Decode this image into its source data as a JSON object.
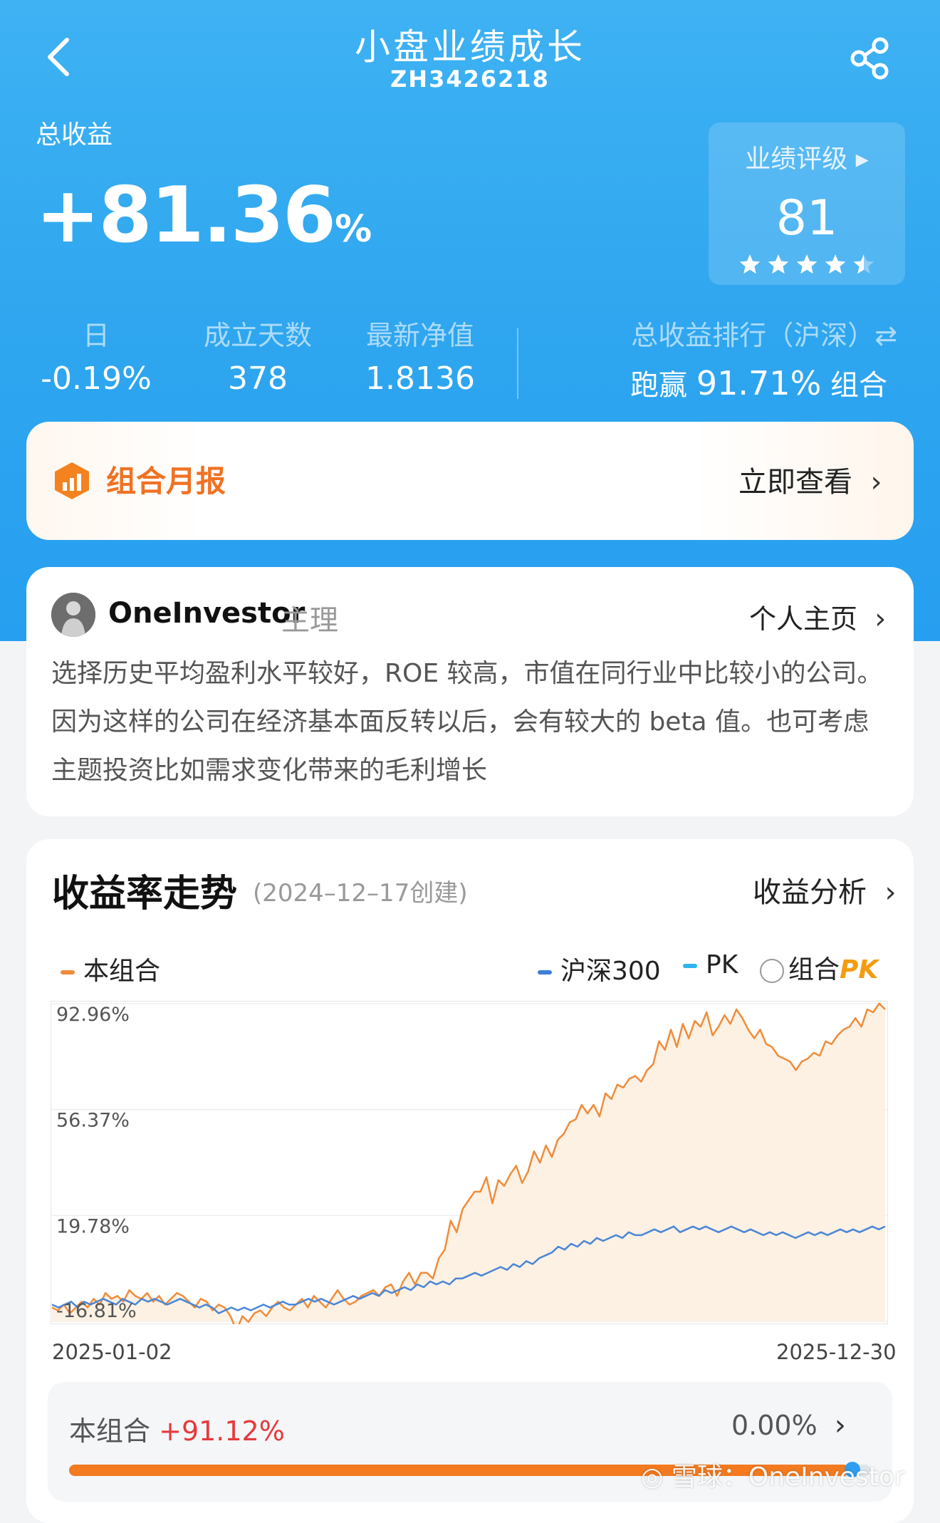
{
  "header": {
    "title": "小盘业绩成长",
    "code": "ZH3426218"
  },
  "total": {
    "label": "总收益",
    "value": "+81.36",
    "unit": "%"
  },
  "rating": {
    "title": "业绩评级 ▸",
    "score": "81",
    "stars": 4.5
  },
  "stats": [
    {
      "label": "日",
      "value": "-0.19%"
    },
    {
      "label": "成立天数",
      "value": "378"
    },
    {
      "label": "最新净值",
      "value": "1.8136"
    }
  ],
  "rank": {
    "label": "总收益排行（沪深）⇄",
    "prefix": "跑赢",
    "value": "91.71%",
    "suffix": "组合"
  },
  "monthly": {
    "label": "组合月报",
    "link": "立即查看"
  },
  "manager": {
    "name": "OneInvestor",
    "role": "主理",
    "homepage": "个人主页",
    "description": "选择历史平均盈利水平较好，ROE 较高，市值在同行业中比较小的公司。因为这样的公司在经济基本面反转以后，会有较大的 beta 值。也可考虑主题投资比如需求变化带来的毛利增长"
  },
  "trend": {
    "title": "收益率走势",
    "subtitle": "(2024–12–17创建)",
    "analysis": "收益分析",
    "legend": {
      "series1": "本组合",
      "series2": "沪深300",
      "pk_prefix": "PK",
      "pk_combo": "组合",
      "pk_mark": "PK"
    },
    "footer": {
      "label": "本组合",
      "value": "+91.12%",
      "right": "0.00%",
      "progress": 0.98
    }
  },
  "chart_data": {
    "type": "line",
    "x_start": "2025-01-02",
    "x_end": "2025-12-30",
    "y_ticks": [
      92.96,
      56.37,
      19.78,
      -16.81
    ],
    "y_tick_labels": [
      "92.96%",
      "56.37%",
      "19.78%",
      "-16.81%"
    ],
    "ylim": [
      -16.81,
      92.96
    ],
    "colors": {
      "portfolio": "#ef8c3a",
      "portfolio_fill": "#fdf1e4",
      "index": "#4a86d6"
    },
    "series": [
      {
        "name": "本组合",
        "values": [
          -12,
          -13,
          -11,
          -14,
          -12,
          -10,
          -12,
          -9,
          -11,
          -7,
          -9,
          -8,
          -10,
          -6,
          -8,
          -9,
          -7,
          -10,
          -8,
          -11,
          -9,
          -7,
          -8,
          -10,
          -12,
          -9,
          -10,
          -13,
          -11,
          -12,
          -15,
          -20,
          -15,
          -17,
          -14,
          -13,
          -15,
          -12,
          -10,
          -12,
          -13,
          -11,
          -9,
          -12,
          -8,
          -10,
          -12,
          -9,
          -6,
          -9,
          -11,
          -10,
          -8,
          -7,
          -6,
          -8,
          -5,
          -4,
          -8,
          -3,
          0,
          -4,
          0,
          0,
          -2,
          5,
          8,
          18,
          14,
          22,
          25,
          28,
          28,
          33,
          24,
          32,
          30,
          34,
          37,
          31,
          35,
          42,
          38,
          44,
          40,
          46,
          48,
          52,
          53,
          58,
          55,
          58,
          54,
          62,
          60,
          65,
          64,
          67,
          68,
          66,
          70,
          72,
          80,
          77,
          84,
          78,
          86,
          81,
          87,
          85,
          90,
          82,
          85,
          89,
          86,
          91,
          88,
          84,
          81,
          84,
          79,
          78,
          75,
          74,
          73,
          70,
          73,
          74,
          76,
          75,
          80,
          79,
          82,
          84,
          85,
          88,
          85,
          91,
          90,
          93,
          91
        ]
      },
      {
        "name": "沪深300",
        "values": [
          -11,
          -12,
          -11,
          -10,
          -12,
          -10,
          -11,
          -10,
          -9,
          -10,
          -11,
          -9,
          -10,
          -11,
          -9,
          -10,
          -9,
          -10,
          -11,
          -10,
          -9,
          -10,
          -11,
          -12,
          -11,
          -12,
          -14,
          -13,
          -12,
          -13,
          -12,
          -13,
          -12,
          -11,
          -12,
          -11,
          -10,
          -11,
          -11,
          -10,
          -9,
          -10,
          -9,
          -10,
          -11,
          -10,
          -9,
          -8,
          -9,
          -8,
          -7,
          -8,
          -6,
          -7,
          -6,
          -5,
          -6,
          -4,
          -5,
          -3,
          -4,
          -3,
          -4,
          -2,
          -2,
          -1,
          0,
          -1,
          0,
          1,
          2,
          1,
          3,
          2,
          4,
          3,
          5,
          6,
          7,
          9,
          8,
          10,
          9,
          11,
          10,
          12,
          11,
          12,
          13,
          12,
          14,
          13,
          13,
          14,
          15,
          14,
          15,
          16,
          14,
          15,
          16,
          15,
          16,
          15,
          14,
          15,
          16,
          15,
          14,
          15,
          14,
          13,
          14,
          13,
          14,
          13,
          12,
          13,
          14,
          13,
          14,
          13,
          14,
          15,
          14,
          15,
          14,
          15,
          16,
          15,
          16
        ]
      }
    ]
  }
}
